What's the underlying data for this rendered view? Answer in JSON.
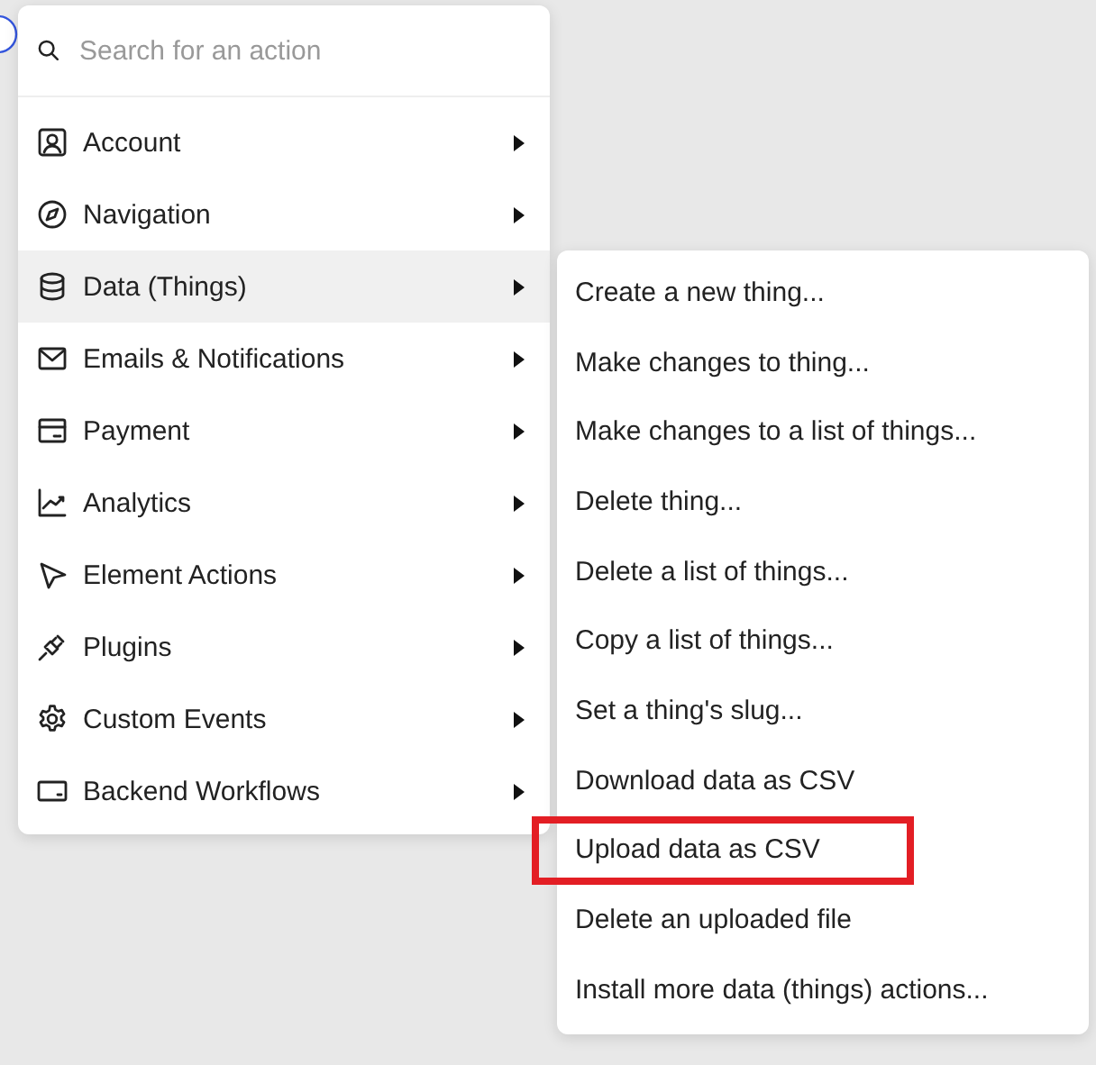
{
  "search": {
    "placeholder": "Search for an action"
  },
  "categories": [
    {
      "label": "Account",
      "selected": false
    },
    {
      "label": "Navigation",
      "selected": false
    },
    {
      "label": "Data (Things)",
      "selected": true
    },
    {
      "label": "Emails & Notifications",
      "selected": false
    },
    {
      "label": "Payment",
      "selected": false
    },
    {
      "label": "Analytics",
      "selected": false
    },
    {
      "label": "Element Actions",
      "selected": false
    },
    {
      "label": "Plugins",
      "selected": false
    },
    {
      "label": "Custom Events",
      "selected": false
    },
    {
      "label": "Backend Workflows",
      "selected": false
    }
  ],
  "submenu": [
    {
      "label": "Create a new thing...",
      "outlined": false
    },
    {
      "label": "Make changes to thing...",
      "outlined": false
    },
    {
      "label": "Make changes to a list of things...",
      "outlined": false
    },
    {
      "label": "Delete thing...",
      "outlined": false
    },
    {
      "label": "Delete a list of things...",
      "outlined": false
    },
    {
      "label": "Copy a list of things...",
      "outlined": false
    },
    {
      "label": "Set a thing's slug...",
      "outlined": false
    },
    {
      "label": "Download data as CSV",
      "outlined": false
    },
    {
      "label": "Upload data as CSV",
      "outlined": true
    },
    {
      "label": "Delete an uploaded file",
      "outlined": false
    },
    {
      "label": "Install more data (things) actions...",
      "outlined": false
    }
  ]
}
